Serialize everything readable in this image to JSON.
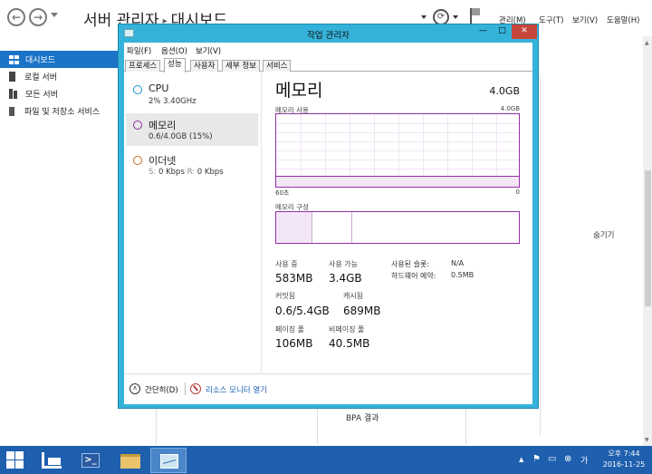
{
  "server_manager": {
    "title_app": "서버 관리자",
    "title_page": "대시보드",
    "menu": {
      "manage": "관리(M)",
      "tools": "도구(T)",
      "view": "보기(V)",
      "help": "도움말(H)"
    },
    "nav": [
      {
        "label": "대시보드",
        "icon": "dashboard-icon",
        "active": true
      },
      {
        "label": "로컬 서버",
        "icon": "local-server-icon"
      },
      {
        "label": "모든 서버",
        "icon": "all-servers-icon"
      },
      {
        "label": "파일 및 저장소 서비스",
        "icon": "file-storage-icon"
      }
    ],
    "background": {
      "hide": "숨기기",
      "bpa": "BPA 결과"
    }
  },
  "task_manager": {
    "title": "작업 관리자",
    "menus": [
      "파일(F)",
      "옵션(O)",
      "보기(V)"
    ],
    "tabs": [
      "프로세스",
      "성능",
      "사용자",
      "세부 정보",
      "서비스"
    ],
    "active_tab": "성능",
    "resources": [
      {
        "name": "CPU",
        "sub": "2% 3.40GHz",
        "color": "#1a8fd1"
      },
      {
        "name": "메모리",
        "sub": "0.6/4.0GB (15%)",
        "color": "#8e2da0",
        "selected": true
      },
      {
        "name": "이더넷",
        "sub_s_label": "S:",
        "sub_s": "0 Kbps",
        "sub_r_label": "R:",
        "sub_r": "0 Kbps",
        "color": "#c46a1a"
      }
    ],
    "detail": {
      "title": "메모리",
      "total": "4.0GB",
      "usage_label": "메모리 사용",
      "usage_max": "4.0GB",
      "usage_fraction": 0.15,
      "axis_left": "60초",
      "axis_right": "0",
      "composition_label": "메모리 구성",
      "stats": {
        "in_use_label": "사용 중",
        "in_use": "583MB",
        "available_label": "사용 가능",
        "available": "3.4GB",
        "speed_label": "사용된 슬롯:",
        "speed": "N/A",
        "hw_reserved_label": "하드웨어 예약:",
        "hw_reserved": "0.5MB",
        "committed_label": "커밋됨",
        "committed": "0.6/5.4GB",
        "cached_label": "캐시됨",
        "cached": "689MB",
        "paged_label": "페이징 풀",
        "paged": "106MB",
        "nonpaged_label": "비페이징 풀",
        "nonpaged": "40.5MB"
      }
    },
    "footer": {
      "fewer_details": "간단히(D)",
      "open_resmon": "리소스 모니터 열기"
    }
  },
  "taskbar": {
    "time": "오후 7:44",
    "date": "2016-11-25"
  },
  "colors": {
    "accent": "#1a73c7",
    "window_frame": "#35b2d9",
    "memory": "#9530a8",
    "taskbar": "#1e5fae"
  }
}
